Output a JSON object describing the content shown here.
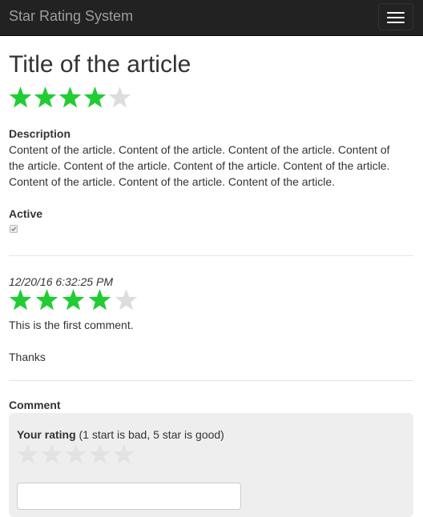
{
  "navbar": {
    "brand": "Star Rating System",
    "toggle_icon": "hamburger-menu-icon"
  },
  "article": {
    "title": "Title of the article",
    "rating": 4,
    "max_rating": 5,
    "description_label": "Description",
    "description": "Content of the article. Content of the article. Content of the article. Content of the article. Content of the article. Content of the article. Content of the article. Content of the article. Content of the article. Content of the article.",
    "active_label": "Active",
    "active": true
  },
  "comments": [
    {
      "timestamp": "12/20/16 6:32:25 PM",
      "rating": 4,
      "max_rating": 5,
      "lines": [
        "This is the first comment.",
        "",
        "Thanks"
      ]
    }
  ],
  "comment_form": {
    "heading": "Comment",
    "rating_label_bold": "Your rating",
    "rating_label_hint": "(1 start is bad, 5 star is good)",
    "rating": 0,
    "max_rating": 5,
    "comment_value": ""
  },
  "colors": {
    "star_filled": "#22cc33",
    "star_empty": "#dddddd",
    "star_empty_form": "#e2e2e2",
    "navbar_bg": "#222222",
    "brand": "#9d9d9d"
  }
}
